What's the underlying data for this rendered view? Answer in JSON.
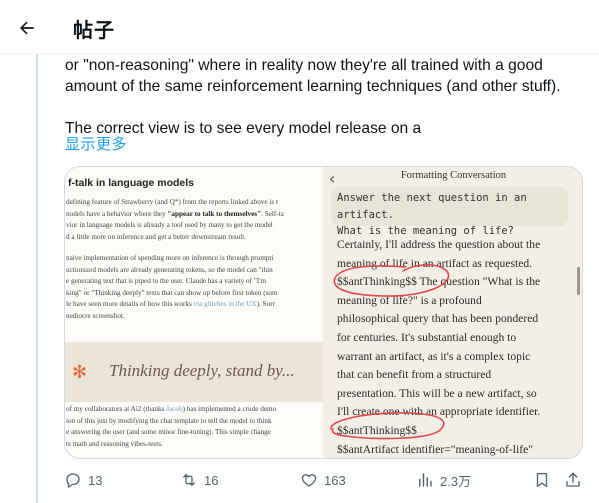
{
  "header": {
    "title": "帖子",
    "back_icon": "arrow-left-icon"
  },
  "tweet": {
    "lines": [
      "or \"non-reasoning\" where in reality now they're all trained with a good",
      "amount of the same reinforcement learning techniques (and other stuff).",
      "The correct view is to see every model release on a"
    ],
    "show_more": "显示更多"
  },
  "article": {
    "heading": "f-talk in language models",
    "para1": [
      "defining feature of Strawberry (and Q*) from the reports linked above is t",
      "nodels have a behavior where they",
      "\"appear to talk to themselves\"",
      ". Self-ta",
      "vior in language models is already a tool used by many to get the model",
      "d a little more on inference and get a better downstream result."
    ],
    "para2": [
      "naive implementation of spending more on inference is through prompti",
      "uctionized models are already generating tokens, so the model can \"thin",
      "e generating text that is piped to the user. Claude has a variety of \"I'm",
      "king\" or \"Thinking deeply\" texts that can show up before first token (som",
      "le have seen more details of how this works",
      "via glitches in the UX",
      "). Sorr",
      "nediocre screenshot."
    ],
    "hero_text": "Thinking deeply, stand by...",
    "hero_icon": "asterisk-icon",
    "para3": [
      "of my collaborators at Ai2 (thanks",
      "Jacob",
      ") has implemented a crude demo",
      "ion of this just by modifying the chat template to tell the model to think",
      "e answering the user (and some minor fine-tuning). This simple change",
      "ts math and reasoning vibes-tests."
    ]
  },
  "chat": {
    "title": "Formatting Conversation",
    "back_icon": "chevron-left-icon",
    "user_message": [
      "Answer the next question in an artifact.",
      "What is the meaning of life?"
    ],
    "reply": [
      "Certainly, I'll address the question about the",
      "meaning of life in an artifact as requested.",
      "$$antThinking$$ The question \"What is the",
      "meaning of life?\" is a profound",
      "philosophical query that has been pondered",
      "for centuries. It's substantial enough to",
      "warrant an artifact, as it's a complex topic",
      "that can benefit from a structured",
      "presentation. This will be a new artifact, so",
      "I'll create one with an appropriate identifier.",
      "$$antThinking$$",
      "$$antArtifact identifier=\"meaning-of-life\""
    ],
    "annotation_color": "#e0484d"
  },
  "actions": {
    "reply_count": "13",
    "repost_count": "16",
    "like_count": "163",
    "views_count": "2.3万",
    "icons": [
      "reply-icon",
      "repost-icon",
      "like-icon",
      "views-icon",
      "bookmark-icon",
      "share-icon"
    ]
  },
  "colors": {
    "link": "#1d9bf0",
    "text": "#0f1419",
    "muted": "#536471",
    "annotation": "#e0484d"
  }
}
